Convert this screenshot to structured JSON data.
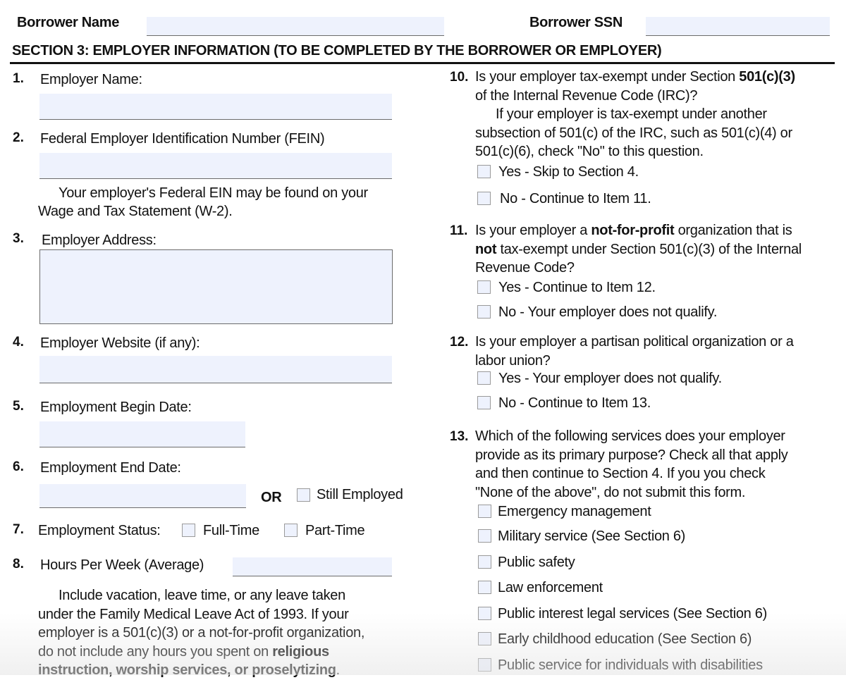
{
  "header": {
    "borrower_name_label": "Borrower Name",
    "borrower_name_value": "",
    "borrower_ssn_label": "Borrower SSN",
    "borrower_ssn_value": "",
    "section_title": "SECTION 3: EMPLOYER INFORMATION (TO BE COMPLETED BY THE BORROWER OR EMPLOYER)"
  },
  "left": {
    "q1": {
      "num": "1.",
      "label": "Employer Name:",
      "value": ""
    },
    "q2": {
      "num": "2.",
      "label": "Federal Employer Identification Number (FEIN)",
      "value": "",
      "note_line1": "Your employer's Federal EIN may be found on your",
      "note_line2": "Wage and Tax Statement (W-2)."
    },
    "q3": {
      "num": "3.",
      "label": "Employer Address:",
      "value": ""
    },
    "q4": {
      "num": "4.",
      "label": "Employer Website (if any):",
      "value": ""
    },
    "q5": {
      "num": "5.",
      "label": "Employment Begin Date:",
      "value": ""
    },
    "q6": {
      "num": "6.",
      "label": "Employment End Date:",
      "value": "",
      "or": "OR",
      "still_employed": "Still Employed",
      "still_employed_checked": false
    },
    "q7": {
      "num": "7.",
      "label": "Employment Status:",
      "full_time": "Full-Time",
      "part_time": "Part-Time",
      "full_time_checked": false,
      "part_time_checked": false
    },
    "q8": {
      "num": "8.",
      "label": "Hours Per Week (Average)",
      "value": "",
      "note": [
        "Include vacation, leave time, or any leave taken",
        "under the Family Medical Leave Act of 1993. If your",
        "employer is a 501(c)(3) or a not-for-profit organization,",
        "do not include any hours you spent on ",
        "religious",
        "instruction, worship services, or proselytizing",
        "."
      ]
    }
  },
  "right": {
    "q10": {
      "num": "10.",
      "line1_a": "Is your employer tax-exempt under Section ",
      "line1_b": "501(c)(3)",
      "line2": "of the Internal Revenue Code (IRC)?",
      "note": [
        "If your employer is tax-exempt under another",
        "subsection of 501(c) of the IRC, such as 501(c)(4) or",
        "501(c)(6), check \"No\" to this question."
      ],
      "options": [
        "Yes - Skip to Section 4.",
        "No - Continue to Item 11."
      ]
    },
    "q11": {
      "num": "11.",
      "line1_a": "Is your employer a ",
      "line1_b": "not-for-profit",
      "line1_c": " organization that is",
      "line2_a": "not",
      "line2_b": " tax-exempt under Section 501(c)(3) of the Internal",
      "line3": "Revenue Code?",
      "options": [
        "Yes - Continue to Item 12.",
        "No - Your employer does not qualify."
      ]
    },
    "q12": {
      "num": "12.",
      "line1": "Is your employer a partisan political organization or a",
      "line2": "labor union?",
      "options": [
        "Yes - Your employer does not qualify.",
        "No - Continue to Item 13."
      ]
    },
    "q13": {
      "num": "13.",
      "lines": [
        "Which of the following services does your employer",
        "provide as its primary purpose? Check all that apply",
        "and then continue to Section 4. If you you check",
        "\"None of the above\", do not submit this form."
      ],
      "options": [
        "Emergency management",
        "Military service (See Section 6)",
        "Public safety",
        "Law enforcement",
        "Public interest legal services (See Section 6)",
        "Early childhood education (See Section 6)",
        "Public service for individuals with disabilities"
      ]
    }
  }
}
